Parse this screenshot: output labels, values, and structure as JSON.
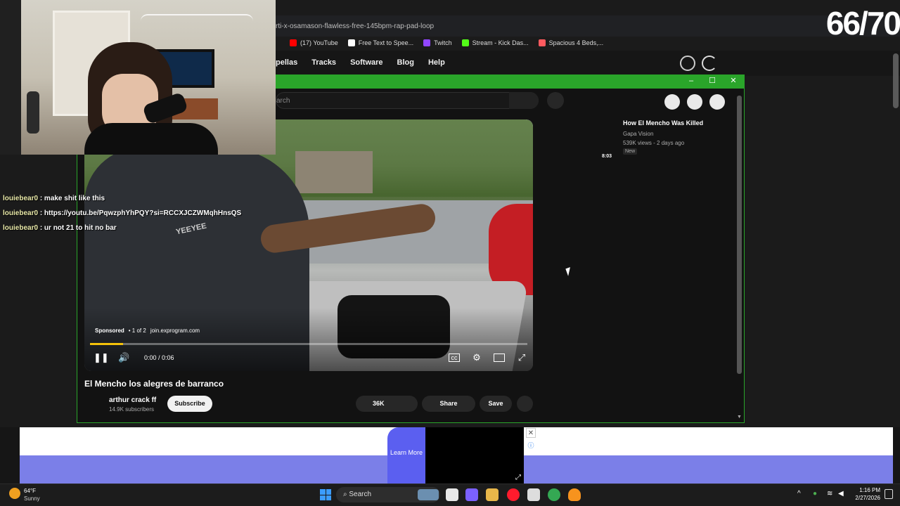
{
  "browser": {
    "url_fragment": "rti-x-osamason-flawless-free-145bpm-rap-pad-loop",
    "bookmarks": [
      {
        "label": "(17) YouTube",
        "color": "#ff0000"
      },
      {
        "label": "Free Text to Spee...",
        "color": "#ffffff"
      },
      {
        "label": "Twitch",
        "color": "#9146ff"
      },
      {
        "label": "Stream - Kick Das...",
        "color": "#53fc18"
      },
      {
        "label": "Spacious 4 Beds,...",
        "color": "#ff5a5f"
      }
    ],
    "nav_links": [
      "pellas",
      "Tracks",
      "Software",
      "Blog",
      "Help"
    ]
  },
  "popup": {
    "minimize": "–",
    "maximize": "☐",
    "close": "✕",
    "search_placeholder": "arch"
  },
  "video": {
    "sponsored_label": "Sponsored",
    "ad_count": "• 1 of 2",
    "ad_domain": "join.exprogram.com",
    "time": "0:00 / 0:06",
    "progress_fraction": 0.075,
    "shirt_text": "YEEYEE"
  },
  "info": {
    "title": "El Mencho los alegres de barranco",
    "channel": "arthur crack ff",
    "subscribers": "14.9K subscribers",
    "subscribe": "Subscribe",
    "likes": "36K",
    "share": "Share",
    "save": "Save"
  },
  "suggestion": {
    "title": "How El Mencho Was Killed",
    "channel": "Gapa Vision",
    "meta": "539K views - 2 days ago",
    "badge": "New",
    "duration": "8:03"
  },
  "chat": [
    {
      "user": "louiebear0",
      "message": ": make shit like this"
    },
    {
      "user": "louiebear0",
      "message": ": https://youtu.be/PqwzphYhPQY?si=RCCXJCZWMqhHnsQS"
    },
    {
      "user": "louiebear0",
      "message": ": ur not 21 to hit no bar"
    }
  ],
  "counter": "66/70",
  "ad": {
    "learn_more": "Learn More",
    "close": "✕",
    "info": "ⓘ"
  },
  "taskbar": {
    "temp": "64°F",
    "condition": "Sunny",
    "search": "Search",
    "time": "1:16 PM",
    "date": "2/27/2026",
    "apps": [
      {
        "name": "file-explorer",
        "color": "#f2c14e"
      },
      {
        "name": "copilot",
        "color": "#7b61ff"
      },
      {
        "name": "folder",
        "color": "#e8b74a"
      },
      {
        "name": "opera",
        "color": "#ff1b2d"
      },
      {
        "name": "store",
        "color": "#dddddd"
      },
      {
        "name": "chrome",
        "color": "#34a853"
      },
      {
        "name": "fl-studio",
        "color": "#f7931e"
      }
    ]
  }
}
